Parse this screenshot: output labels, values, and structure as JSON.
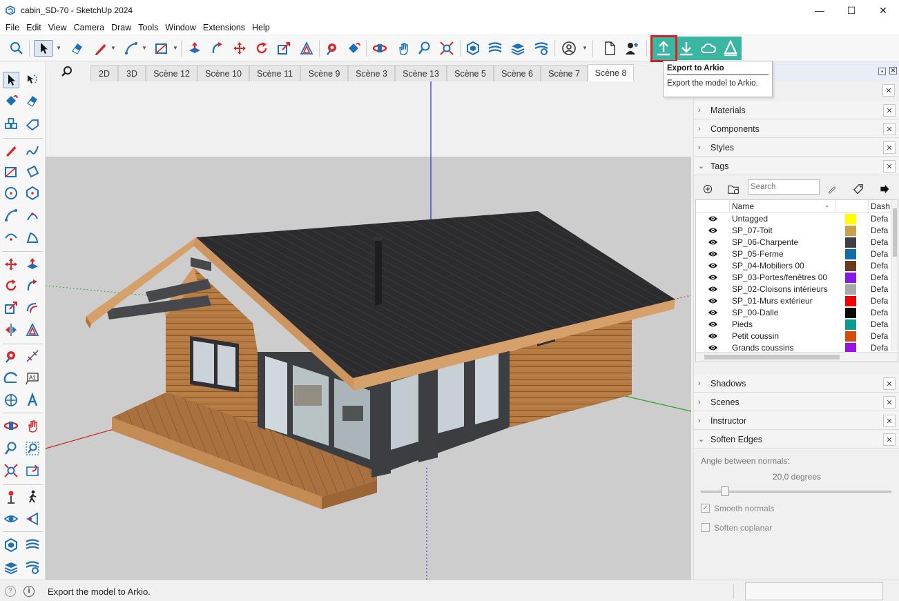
{
  "window": {
    "title": "cabin_SD-70 - SketchUp 2024",
    "minimize": "—",
    "maximize": "☐",
    "close": "✕"
  },
  "menu": [
    "File",
    "Edit",
    "View",
    "Camera",
    "Draw",
    "Tools",
    "Window",
    "Extensions",
    "Help"
  ],
  "scene_tabs": [
    "2D",
    "3D",
    "Scène 12",
    "Scène 10",
    "Scène 11",
    "Scène 9",
    "Scène 3",
    "Scène 13",
    "Scène 5",
    "Scène 6",
    "Scène 7",
    "Scène 8"
  ],
  "active_scene": "Scène 8",
  "tooltip": {
    "title": "Export to Arkio",
    "description": "Export the model to Arkio."
  },
  "tray": {
    "panels_top": [
      {
        "label": "Materials",
        "chevron": "›"
      },
      {
        "label": "Components",
        "chevron": "›"
      },
      {
        "label": "Styles",
        "chevron": "›"
      },
      {
        "label": "Tags",
        "chevron": "⌄"
      }
    ],
    "panels_bottom": [
      {
        "label": "Shadows",
        "chevron": "›"
      },
      {
        "label": "Scenes",
        "chevron": "›"
      },
      {
        "label": "Instructor",
        "chevron": "›"
      },
      {
        "label": "Soften Edges",
        "chevron": "⌄"
      }
    ],
    "close_glyph": "✕"
  },
  "tags": {
    "search_placeholder": "Search",
    "col_name": "Name",
    "col_dash": "Dash",
    "rows": [
      {
        "name": "Untagged",
        "color": "#ffff00",
        "dash": "Defa"
      },
      {
        "name": "SP_07-Toit",
        "color": "#c9a14e",
        "dash": "Defa"
      },
      {
        "name": "SP_06-Charpente",
        "color": "#404040",
        "dash": "Defa"
      },
      {
        "name": "SP_05-Ferme",
        "color": "#0f6ea8",
        "dash": "Defa"
      },
      {
        "name": "SP_04-Mobiliers 00",
        "color": "#6b3a1f",
        "dash": "Defa"
      },
      {
        "name": "SP_03-Portes/fenêtres 00",
        "color": "#8a16e8",
        "dash": "Defa"
      },
      {
        "name": "SP_02-Cloisons intérieurs",
        "color": "#a9a9a9",
        "dash": "Defa"
      },
      {
        "name": "SP_01-Murs extérieur",
        "color": "#f00000",
        "dash": "Defa"
      },
      {
        "name": "SP_00-Dalle",
        "color": "#0a0a0a",
        "dash": "Defa"
      },
      {
        "name": "Pieds",
        "color": "#0c9b8d",
        "dash": "Defa"
      },
      {
        "name": "Petit coussin",
        "color": "#d24d09",
        "dash": "Defa"
      },
      {
        "name": "Grands coussins",
        "color": "#9a12e8",
        "dash": "Defa"
      }
    ]
  },
  "soften_edges": {
    "angle_label": "Angle between normals:",
    "angle_value": "20,0  degrees",
    "angle_degrees": 20,
    "smooth_normals_label": "Smooth normals",
    "smooth_normals_checked": true,
    "soften_coplanar_label": "Soften coplanar",
    "soften_coplanar_checked": false
  },
  "status": {
    "text": "Export the model to Arkio.",
    "icon_geo": "?",
    "icon_info": "i"
  },
  "colors": {
    "arkio_teal": "#3ab7a3",
    "highlight_red": "#e01b1b",
    "sketchup_blue": "#1d6fb8",
    "sketchup_red": "#d9262b"
  }
}
